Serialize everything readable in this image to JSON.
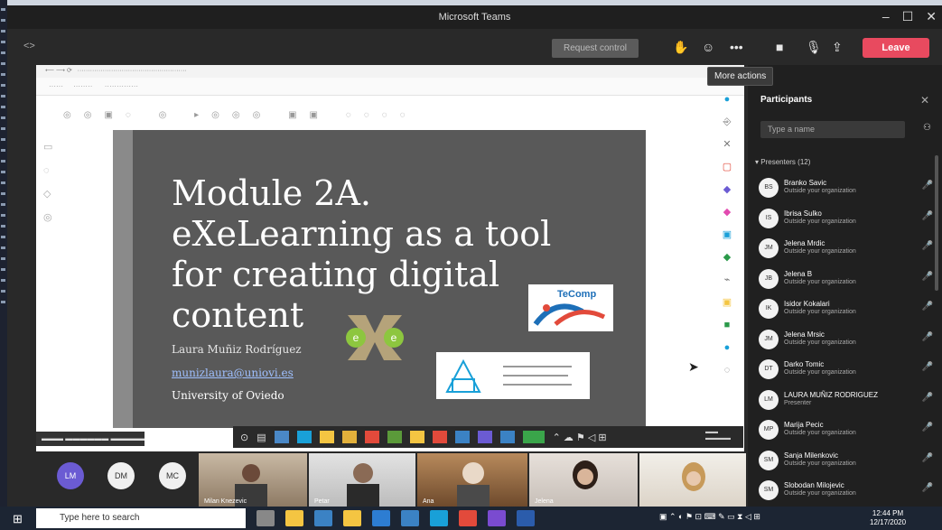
{
  "window": {
    "title": "Microsoft Teams"
  },
  "toolbar": {
    "back": "<>",
    "request_control": "Request control",
    "leave": "Leave",
    "tooltip": "More actions"
  },
  "shared_screen": {
    "slide": {
      "title_lines": [
        "Module 2A.",
        "eXeLearning as a tool",
        "for creating digital",
        "content"
      ],
      "author": "Laura Muñiz Rodríguez",
      "email": "munizlaura@uniovi.es",
      "university": "University of Oviedo",
      "logo_label": "TeComp"
    }
  },
  "videos": {
    "avatars": [
      {
        "initials": "LM",
        "color": "#6b5bd3"
      },
      {
        "initials": "DM",
        "color": "#f0f0f0"
      },
      {
        "initials": "MC",
        "color": "#f0f0f0"
      }
    ],
    "tiles": [
      {
        "label": "Milan Knezevic"
      },
      {
        "label": "Petar"
      },
      {
        "label": "Ana"
      },
      {
        "label": "Jelena"
      },
      {
        "label": ""
      }
    ]
  },
  "participants": {
    "title": "Participants",
    "search_placeholder": "Type a name",
    "section_label": "Presenters (12)",
    "list": [
      {
        "initials": "BS",
        "name": "Branko Savic",
        "sub": "Outside your organization",
        "mic": "🎤"
      },
      {
        "initials": "IS",
        "name": "Ibrisa Sulko",
        "sub": "Outside your organization",
        "mic": "🎤"
      },
      {
        "initials": "JM",
        "name": "Jelena Mrdic",
        "sub": "Outside your organization",
        "mic": "🎤"
      },
      {
        "initials": "JB",
        "name": "Jelena B",
        "sub": "Outside your organization",
        "mic": "🎤"
      },
      {
        "initials": "IK",
        "name": "Isidor Kokalari",
        "sub": "Outside your organization",
        "mic": "🎤"
      },
      {
        "initials": "JM",
        "name": "Jelena Mrsic",
        "sub": "Outside your organization",
        "mic": "🎤"
      },
      {
        "initials": "DT",
        "name": "Darko Tomic",
        "sub": "Outside your organization",
        "mic": "🎤"
      },
      {
        "initials": "LM",
        "name": "LAURA MUÑIZ RODRIGUEZ",
        "sub": "Presenter",
        "mic": "🎤"
      },
      {
        "initials": "MP",
        "name": "Marija Pecic",
        "sub": "Outside your organization",
        "mic": "🎤"
      },
      {
        "initials": "SM",
        "name": "Sanja Milenkovic",
        "sub": "Outside your organization",
        "mic": "🎤"
      },
      {
        "initials": "SM",
        "name": "Slobodan Milojevic",
        "sub": "Outside your organization",
        "mic": "🎤"
      }
    ]
  },
  "taskbar": {
    "search_placeholder": "Type here to search",
    "clock_time": "12:44 PM",
    "clock_date": "12/17/2020",
    "app_colors": [
      "#888888",
      "#f4c542",
      "#3b82c4",
      "#f4c542",
      "#2d7dd2",
      "#3b82c4",
      "#19a0d8",
      "#e24a3b",
      "#7a4bd0",
      "#2b5cab"
    ]
  }
}
